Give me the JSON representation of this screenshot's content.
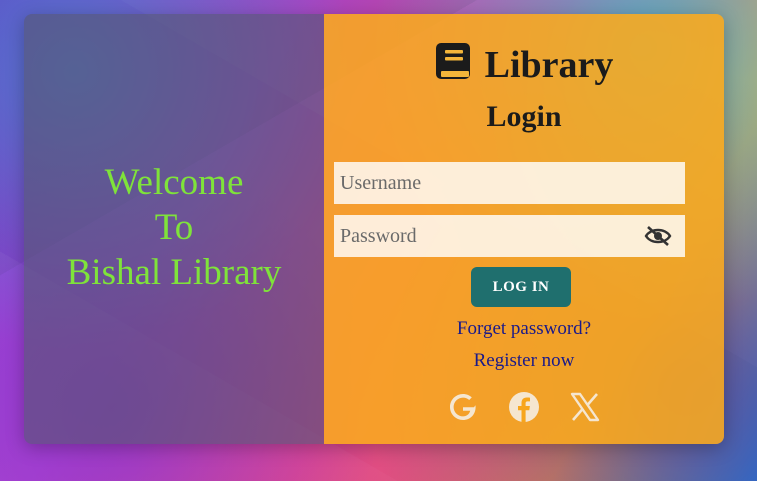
{
  "welcome": {
    "line1": "Welcome",
    "line2": "To",
    "line3": "Bishal Library"
  },
  "brand": {
    "title": "Library",
    "icon": "book-icon"
  },
  "login": {
    "title": "Login",
    "username_placeholder": "Username",
    "password_placeholder": "Password",
    "password_toggle_icon": "eye-slash-icon",
    "submit_label": "LOG IN",
    "forgot_label": "Forget password?",
    "register_label": "Register now"
  },
  "social": [
    {
      "name": "google-icon"
    },
    {
      "name": "facebook-icon"
    },
    {
      "name": "x-icon"
    }
  ],
  "colors": {
    "welcome_text": "#7fe33a",
    "right_panel": "#faaa1e",
    "button": "#1f6f6e",
    "link": "#1a1a8a",
    "icon": "#f5e6d0"
  }
}
